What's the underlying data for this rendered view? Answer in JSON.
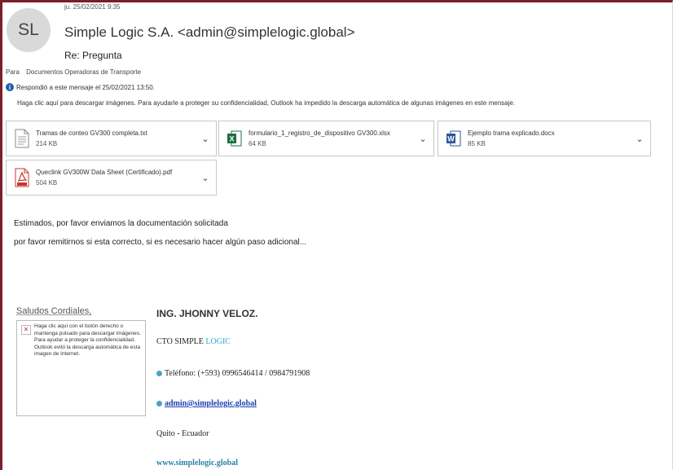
{
  "header": {
    "avatar_initials": "SL",
    "datetime": "ju. 25/02/2021 9:35",
    "from": "Simple Logic S.A. <admin@simplelogic.global>",
    "subject": "Re: Pregunta",
    "to_label": "Para",
    "to_value": "Documentos Operadoras de Transporte",
    "info_text": "Respondió a este mensaje el 25/02/2021 13:50.",
    "download_text": "Haga clic aquí para descargar imágenes. Para ayudarle a proteger su confidencialidad, Outlook ha impedido la descarga automática de algunas imágenes en este mensaje."
  },
  "attachments": [
    {
      "name": "Tramas de conteo GV300 completa.txt",
      "size": "214 KB",
      "icon": "text-file-icon"
    },
    {
      "name": "formulario_1_registro_de_dispositivo GV300.xlsx",
      "size": "64 KB",
      "icon": "excel-icon"
    },
    {
      "name": "Ejemplo trama explicado.docx",
      "size": "85 KB",
      "icon": "word-icon"
    },
    {
      "name": "Queclink GV300W Data Sheet (Certificado).pdf",
      "size": "504 KB",
      "icon": "pdf-icon"
    }
  ],
  "body": {
    "line1": "Estimados, por favor enviamos la documentación solicitada",
    "line2": "por favor remitirnos si esta correcto, si es necesario hacer algún paso adicional..."
  },
  "signature": {
    "greeting": "Saludos Cordiales,",
    "blocked_image_text": "Haga clic aquí con el botón derecho o mantenga pulsado para descargar imágenes. Para ayudar a proteger la confidencialidad, Outlook evitó la descarga automática de esta imagen de Internet.",
    "name": "ING. JHONNY VELOZ.",
    "role_prefix": "CTO SIMPLE ",
    "role_accent": "LOGIC",
    "phone": "Teléfono: (+593) 0996546414 / 0984791908",
    "email": "admin@simplelogic.global",
    "city": "Quito - Ecuador",
    "website": "www.simplelogic.global"
  },
  "colors": {
    "frame_accent": "#7a1f2b",
    "link": "#1a3fb0",
    "logic_accent": "#2aa8c8"
  }
}
